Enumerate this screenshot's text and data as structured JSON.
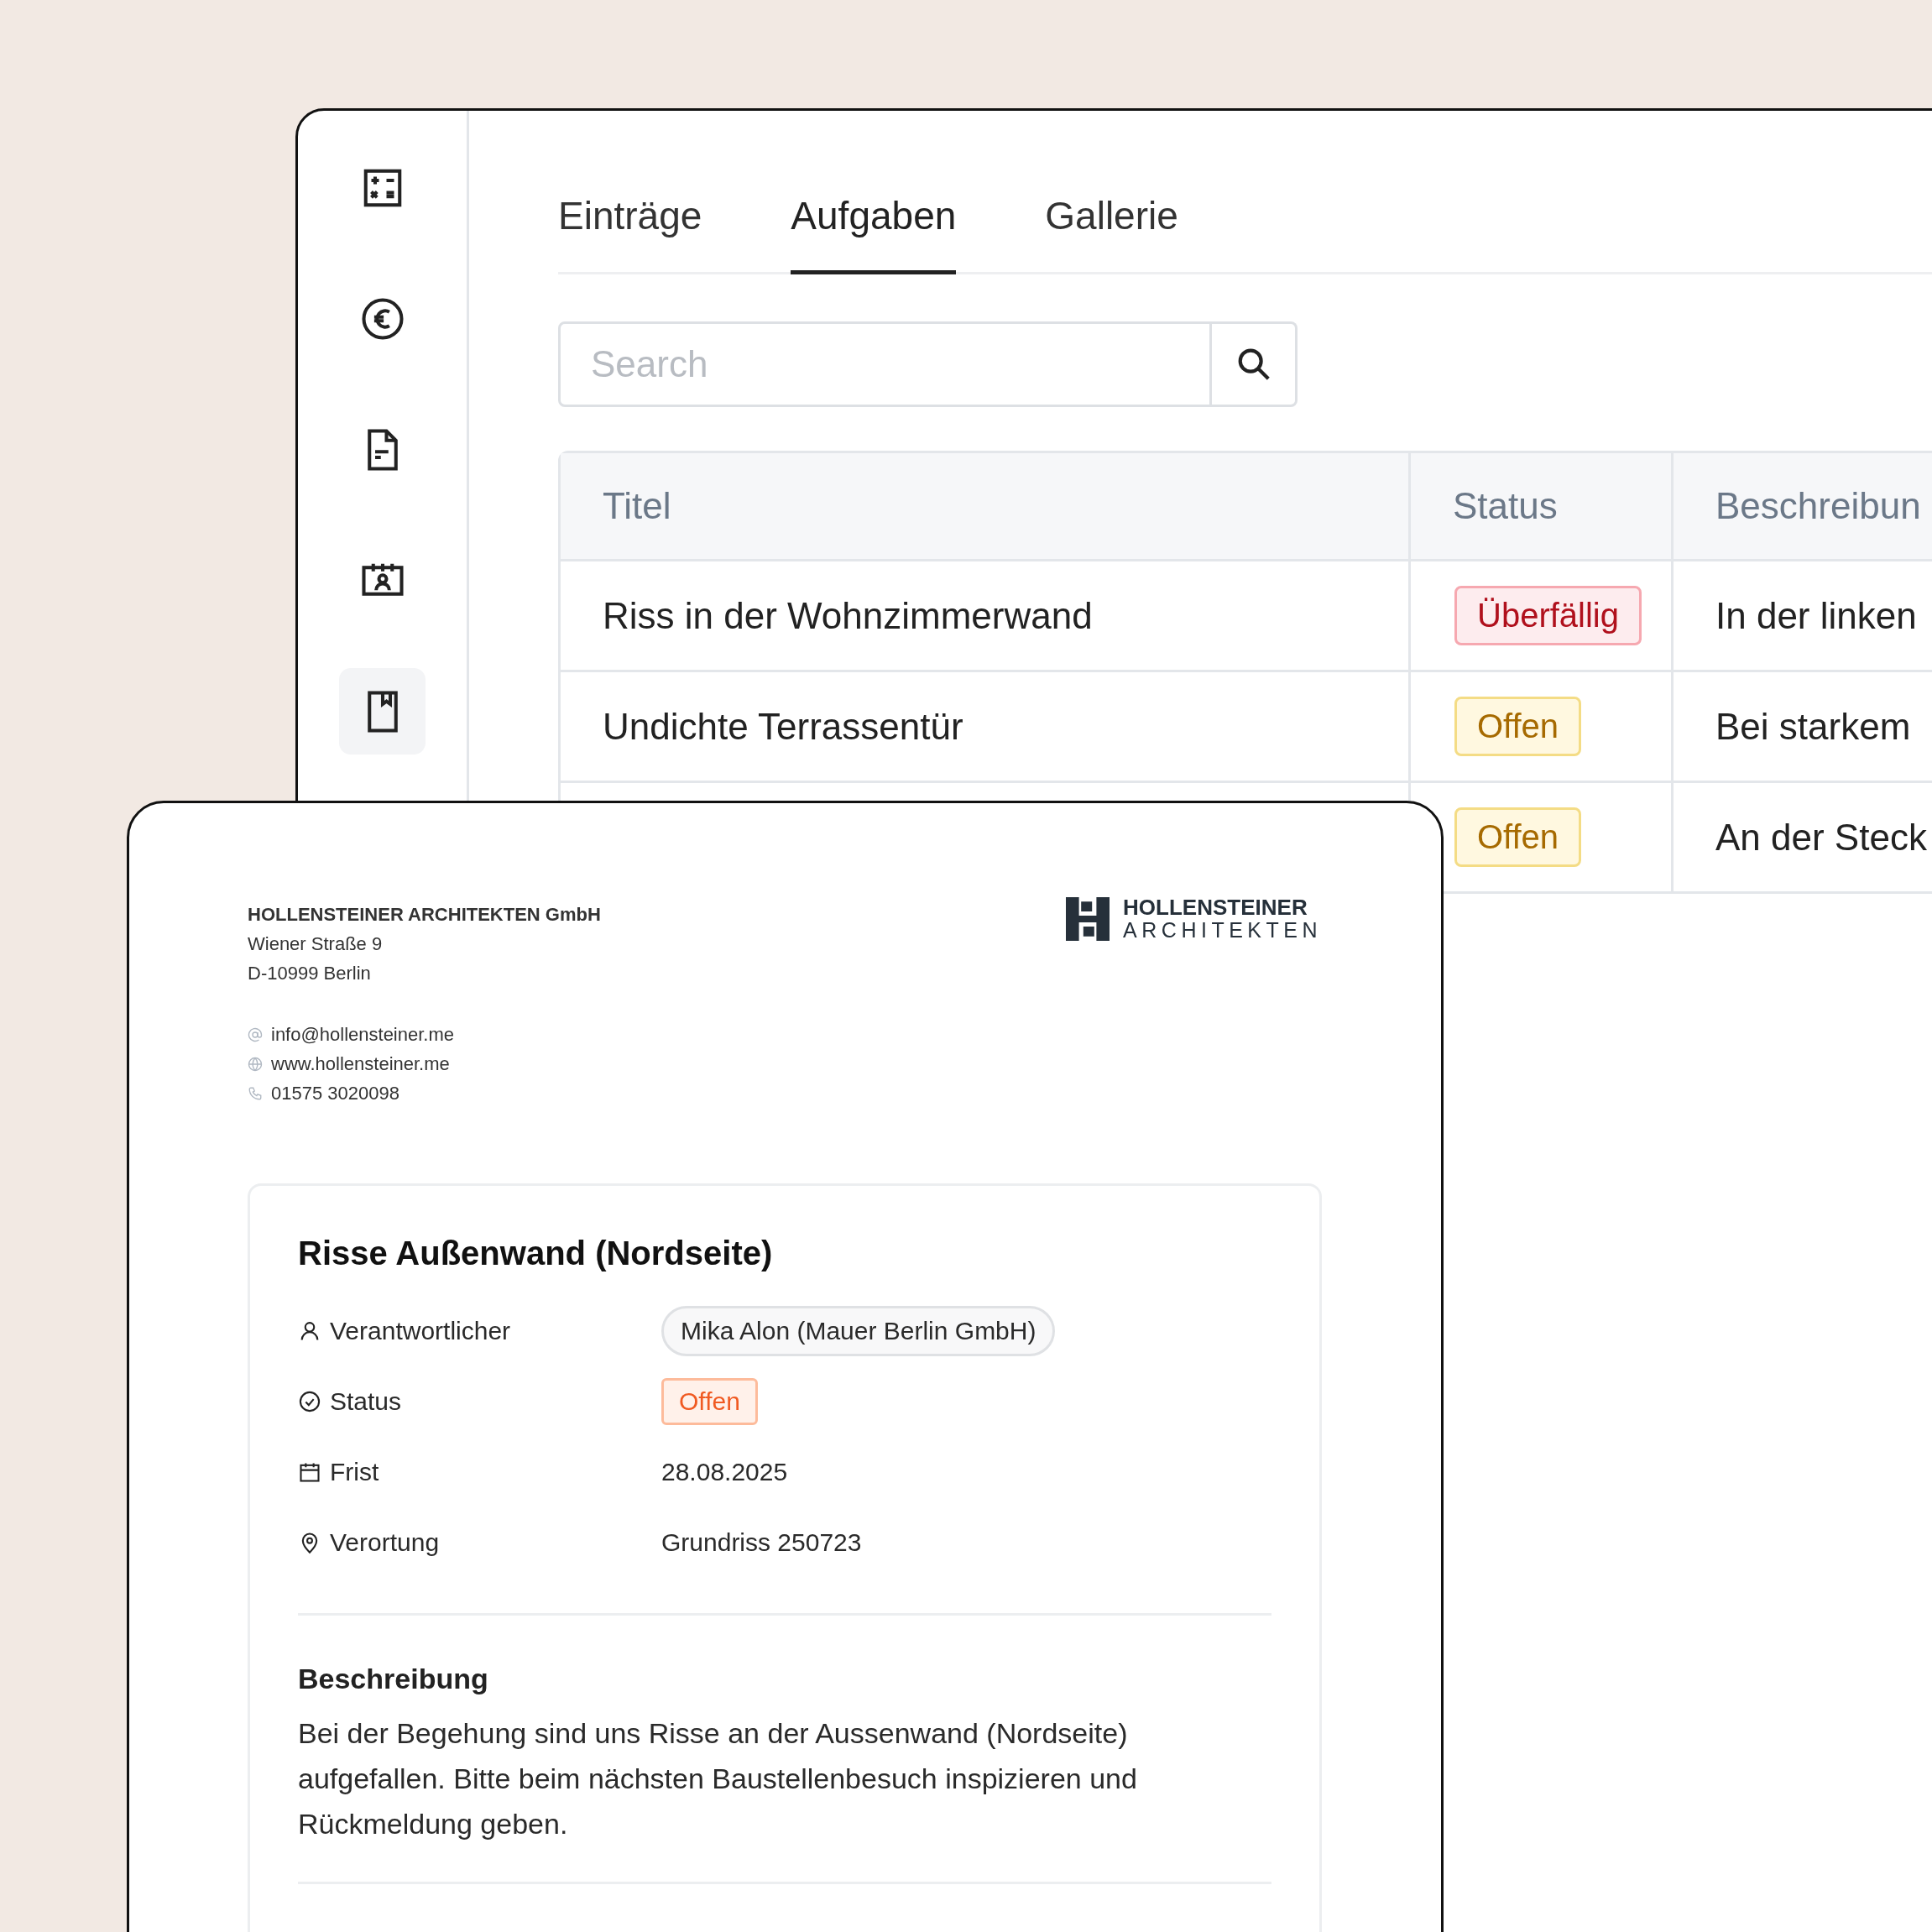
{
  "sidebar": {
    "items": [
      {
        "kind": "calculator",
        "selected": false
      },
      {
        "kind": "euro",
        "selected": false
      },
      {
        "kind": "document",
        "selected": false
      },
      {
        "kind": "contact-calendar",
        "selected": false
      },
      {
        "kind": "bookmark",
        "selected": true
      }
    ]
  },
  "tabs": [
    {
      "label": "Einträge",
      "selected": false
    },
    {
      "label": "Aufgaben",
      "selected": true
    },
    {
      "label": "Gallerie",
      "selected": false
    }
  ],
  "search": {
    "placeholder": "Search"
  },
  "table": {
    "columns": [
      "Titel",
      "Status",
      "Beschreibun"
    ],
    "rows": [
      {
        "title": "Riss in der Wohnzimmerwand",
        "status": {
          "label": "Überfällig",
          "kind": "overdue"
        },
        "description": "In der linken"
      },
      {
        "title": "Undichte Terrassentür",
        "status": {
          "label": "Offen",
          "kind": "open"
        },
        "description": "Bei starkem"
      },
      {
        "status": {
          "label": "Offen",
          "kind": "open"
        },
        "description": "An der Steck"
      }
    ]
  },
  "document": {
    "company": {
      "name": "HOLLENSTEINER ARCHITEKTEN GmbH",
      "street": "Wiener Straße 9",
      "city": "D-10999 Berlin"
    },
    "contacts": [
      {
        "kind": "email",
        "text": "info@hollensteiner.me"
      },
      {
        "kind": "web",
        "text": "www.hollensteiner.me"
      },
      {
        "kind": "phone",
        "text": "01575 3020098"
      }
    ],
    "logo": {
      "line1": "HOLLENSTEINER",
      "line2": "ARCHITEKTEN"
    },
    "task": {
      "title": "Risse Außenwand (Nordseite)",
      "fields": [
        {
          "label": "Verantwortlicher",
          "kind": "pill",
          "value": "Mika Alon (Mauer Berlin GmbH)"
        },
        {
          "label": "Status",
          "kind": "badge",
          "value": "Offen"
        },
        {
          "label": "Frist",
          "kind": "text",
          "value": "28.08.2025"
        },
        {
          "label": "Verortung",
          "kind": "text",
          "value": "Grundriss 250723"
        }
      ],
      "description_heading": "Beschreibung",
      "description": "Bei der Begehung sind uns Risse an der Aussenwand (Nordseite) aufgefallen. Bitte beim nächsten Baustellenbesuch inspizieren und Rückmeldung geben."
    }
  }
}
